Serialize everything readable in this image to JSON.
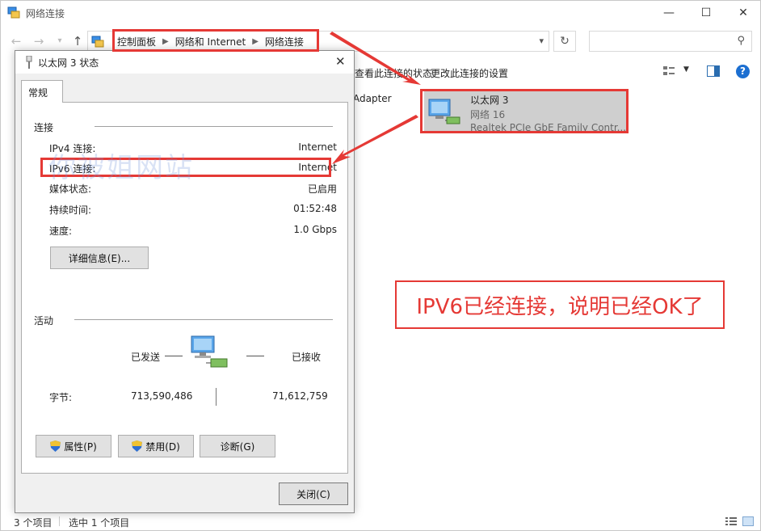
{
  "window": {
    "title": "网络连接",
    "min_glyph": "—",
    "max_glyph": "☐",
    "close_glyph": "✕"
  },
  "address": {
    "crumbs": [
      "控制面板",
      "网络和 Internet",
      "网络连接"
    ]
  },
  "commands": {
    "view_status": "查看此连接的状态",
    "change_settings": "更改此连接的设置"
  },
  "list": {
    "partial_item": "Adapter",
    "selected_item": {
      "name": "以太网 3",
      "network": "网络 16",
      "adapter": "Realtek PCIe GbE Family Contr..."
    }
  },
  "statusbar": {
    "count": "3 个项目",
    "selected": "选中 1 个项目"
  },
  "dialog": {
    "title": "以太网 3 状态",
    "tab": "常规",
    "connection_section": "连接",
    "rows": [
      {
        "label": "IPv4 连接:",
        "value": "Internet"
      },
      {
        "label": "IPv6 连接:",
        "value": "Internet"
      },
      {
        "label": "媒体状态:",
        "value": "已启用"
      },
      {
        "label": "持续时间:",
        "value": "01:52:48"
      },
      {
        "label": "速度:",
        "value": "1.0 Gbps"
      }
    ],
    "details_button": "详细信息(E)...",
    "activity_section": "活动",
    "sent_label": "已发送",
    "received_label": "已接收",
    "bytes_label": "字节:",
    "bytes_sent": "713,590,486",
    "bytes_received": "71,612,759",
    "properties_button": "属性(P)",
    "disable_button": "禁用(D)",
    "diagnose_button": "诊断(G)",
    "close_button": "关闭(C)"
  },
  "annotation": {
    "callout_text": "IPV6已经连接，说明已经OK了",
    "watermark": "你被姐网站",
    "color": "#e53935"
  }
}
